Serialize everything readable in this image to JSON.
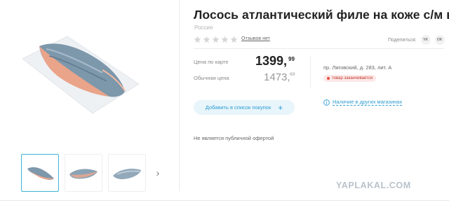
{
  "product": {
    "title": "Лосось атлантический филе на коже с/м вес",
    "country": "Россия",
    "rating": {
      "stars": 0,
      "max": 5,
      "reviews_label": "Отзывов нет"
    },
    "share": {
      "label": "Поделиться:",
      "buttons": [
        "VK",
        "OK"
      ]
    }
  },
  "prices": {
    "card": {
      "label": "Цена по карте",
      "integer": "1399,",
      "fraction": "99"
    },
    "regular": {
      "label": "Обычная цена",
      "integer": "1473,",
      "fraction": "69"
    }
  },
  "store": {
    "address": "пр. Лиговский, д. 283, лит. А",
    "stock_status": "товар заканчивается"
  },
  "actions": {
    "add_to_list": "Добавить в список покупок",
    "add_to_list_icon": "+",
    "other_stores": "Наличие в других магазинах"
  },
  "disclaimer": "Не является публичной офертой",
  "gallery": {
    "thumbnails": 3,
    "next_icon": "›"
  },
  "watermark": "YAPLAKAL.COM",
  "colors": {
    "accent": "#2d9cd0",
    "stock": "#c0392b",
    "stock_bg": "#fde8e8",
    "button_bg": "#e8f5fb"
  }
}
